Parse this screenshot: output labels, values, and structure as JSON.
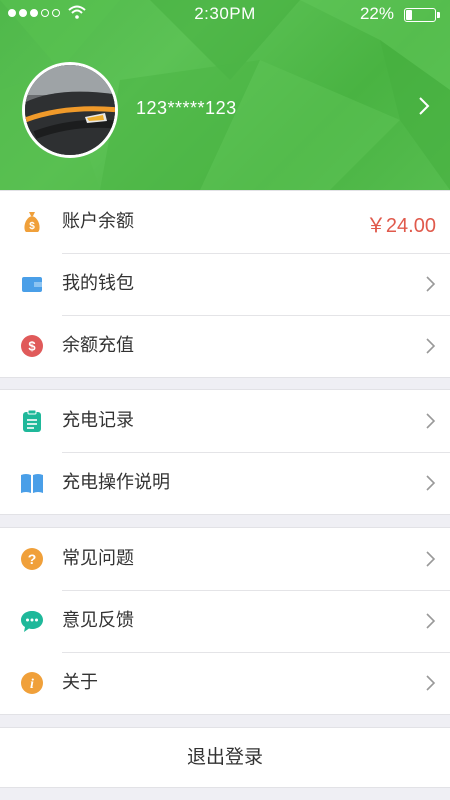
{
  "status_bar": {
    "time": "2:30PM",
    "battery_percent": "22%",
    "battery_level": 0.22,
    "signal_bars_filled": 3,
    "signal_bars_total": 5
  },
  "profile": {
    "username": "123*****123",
    "avatar_icon": "car-photo-avatar"
  },
  "groups": [
    {
      "rows": [
        {
          "label": "账户余额",
          "icon": "money-bag-icon",
          "value": "￥24.00"
        },
        {
          "label": "我的钱包",
          "icon": "wallet-icon"
        },
        {
          "label": "余额充值",
          "icon": "dollar-circle-icon"
        }
      ]
    },
    {
      "rows": [
        {
          "label": "充电记录",
          "icon": "clipboard-icon"
        },
        {
          "label": "充电操作说明",
          "icon": "book-icon"
        }
      ]
    },
    {
      "rows": [
        {
          "label": "常见问题",
          "icon": "question-icon"
        },
        {
          "label": "意见反馈",
          "icon": "chat-bubble-icon"
        },
        {
          "label": "关于",
          "icon": "info-icon"
        }
      ]
    }
  ],
  "logout_label": "退出登录",
  "colors": {
    "header_green": "#4fb84a",
    "amount_red": "#e05a4c",
    "orange": "#f0a03a",
    "teal": "#1fb89a",
    "blue": "#4a9fe8",
    "red": "#e05a5a"
  }
}
